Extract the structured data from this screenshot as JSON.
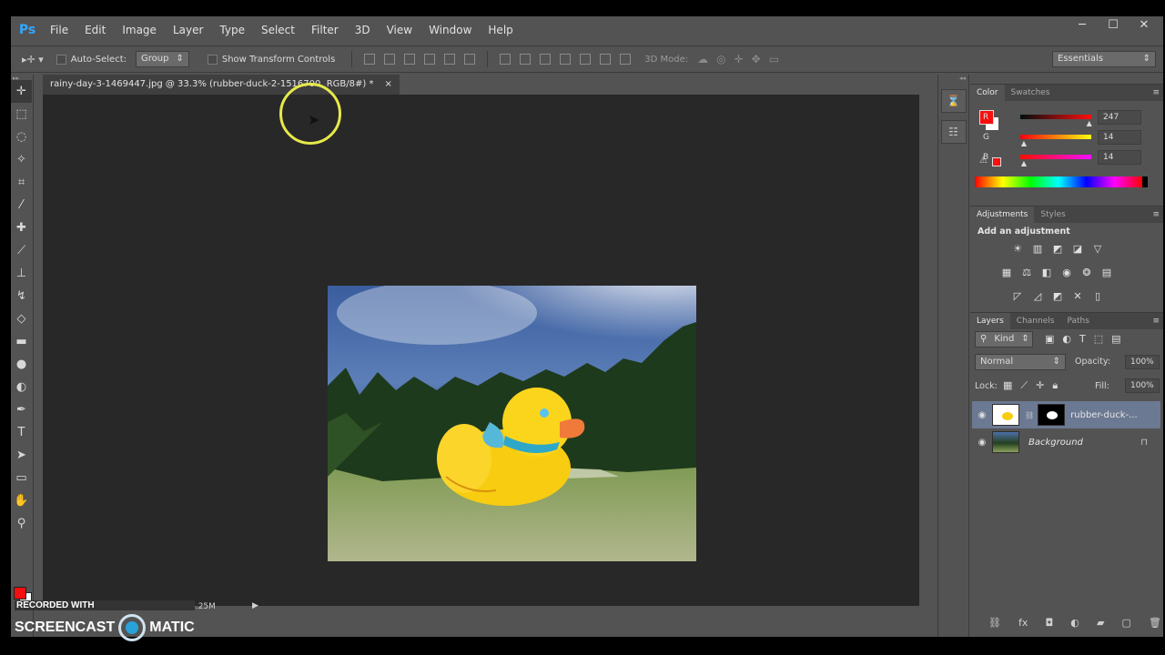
{
  "app": {
    "logo": "Ps"
  },
  "menu": [
    "File",
    "Edit",
    "Image",
    "Layer",
    "Type",
    "Select",
    "Filter",
    "3D",
    "View",
    "Window",
    "Help"
  ],
  "window_controls": [
    "─",
    "☐",
    "✕"
  ],
  "options": {
    "auto_select_label": "Auto-Select:",
    "group_value": "Group",
    "transform_label": "Show Transform Controls",
    "mode_3d_label": "3D Mode:",
    "workspace": "Essentials"
  },
  "tools": [
    "move",
    "marquee",
    "lasso",
    "quick-select",
    "crop",
    "eyedropper",
    "healing",
    "brush",
    "clone-stamp",
    "history-brush",
    "eraser",
    "gradient",
    "blur",
    "dodge",
    "pen",
    "type",
    "path-select",
    "rectangle",
    "hand",
    "zoom"
  ],
  "document": {
    "tab_title": "rainy-day-3-1469447.jpg @ 33.3% (rubber-duck-2-1516700, RGB/8#) *",
    "tab_close": "×",
    "status": "Doc: 3.52M/8.25M"
  },
  "color_panel": {
    "tabs": [
      "Color",
      "Swatches"
    ],
    "channels": [
      {
        "label": "R",
        "value": "247",
        "fraction": 0.97
      },
      {
        "label": "G",
        "value": "14",
        "fraction": 0.05
      },
      {
        "label": "B",
        "value": "14",
        "fraction": 0.05
      }
    ],
    "foreground": "#f70e0e"
  },
  "adjustments_panel": {
    "tabs": [
      "Adjustments",
      "Styles"
    ],
    "title": "Add an adjustment"
  },
  "layers_panel": {
    "tabs": [
      "Layers",
      "Channels",
      "Paths"
    ],
    "filter": "Kind",
    "blend_mode": "Normal",
    "opacity_label": "Opacity:",
    "opacity": "100%",
    "lock_label": "Lock:",
    "fill_label": "Fill:",
    "fill": "100%",
    "layers": [
      {
        "name": "rubber-duck-...",
        "selected": true
      },
      {
        "name": "Background",
        "selected": false
      }
    ]
  },
  "watermark": {
    "line1": "RECORDED WITH",
    "line2a": "SCREENCAST",
    "line2b": "MATIC"
  }
}
